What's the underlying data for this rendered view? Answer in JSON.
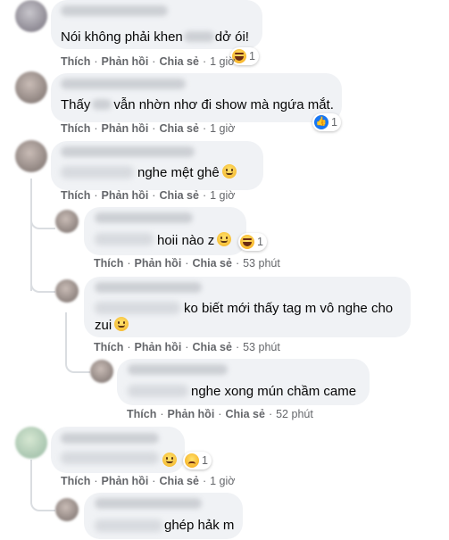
{
  "actions": {
    "like": "Thích",
    "reply": "Phản hồi",
    "share": "Chia sẻ",
    "dot": "·"
  },
  "comments": [
    {
      "text": "Nói không phải khen",
      "text_after": "dở ói!",
      "time": "1 giờ",
      "reaction_count": "1",
      "reaction": "haha-icon"
    },
    {
      "text": "Thấy",
      "text_after": "vẫn nhờn nhơ đi show mà ngứa mắt.",
      "time": "1 giờ",
      "reaction_count": "1",
      "reaction": "like-icon"
    },
    {
      "text": "nghe mệt ghê",
      "time": "1 giờ"
    },
    {
      "text": "hoii nào z",
      "time": "53 phút",
      "reaction_count": "1",
      "reaction": "haha-icon"
    },
    {
      "text": "ko biết mới thấy tag m vô nghe cho",
      "text_line2": "zui",
      "time": "53 phút"
    },
    {
      "text": "nghe xong mún chầm came",
      "time": "52 phút"
    },
    {
      "time": "1 giờ",
      "reaction_count": "1",
      "reaction": "sad-icon"
    },
    {
      "text": "ghép hảk m"
    }
  ],
  "colors": {
    "bubble": "#f0f2f5",
    "meta": "#65676b",
    "text": "#050505",
    "like": "#1877f2"
  }
}
